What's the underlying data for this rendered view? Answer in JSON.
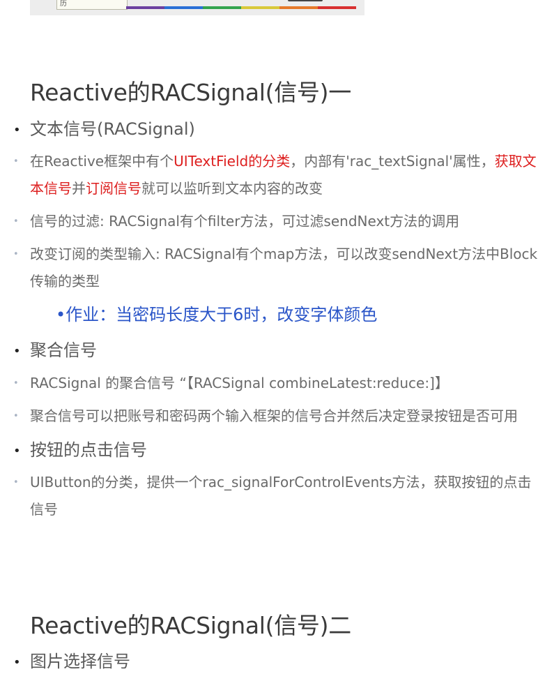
{
  "top_image": {
    "caption_fragment": "历",
    "stripe_colors": [
      "#6b3fa0",
      "#2a6fd6",
      "#33a44e",
      "#d9c93a",
      "#e67a2b",
      "#d83030"
    ]
  },
  "section1": {
    "title": "Reactive的RACSignal(信号)一",
    "items": [
      {
        "level": 1,
        "text": "文本信号(RACSignal)"
      },
      {
        "level": 2,
        "runs": [
          {
            "text": "在Reactive框架中有个",
            "style": "normal"
          },
          {
            "text": "UITextField的分类",
            "style": "red"
          },
          {
            "text": "，内部有'rac_textSignal'属性，",
            "style": "normal"
          },
          {
            "text": "获取文本信号",
            "style": "red"
          },
          {
            "text": "并",
            "style": "normal"
          },
          {
            "text": "订阅信号",
            "style": "red"
          },
          {
            "text": "就可以监听到文本内容的改变",
            "style": "normal"
          }
        ]
      },
      {
        "level": 2,
        "text": "信号的过滤: RACSignal有个filter方法，可过滤sendNext方法的调用"
      },
      {
        "level": 2,
        "text": "改变订阅的类型输入: RACSignal有个map方法，可以改变sendNext方法中Block传输的类型"
      },
      {
        "level": 3,
        "text": "•作业：当密码长度大于6时，改变字体颜色"
      },
      {
        "level": 1,
        "text": "聚合信号"
      },
      {
        "level": 2,
        "text": "RACSignal 的聚合信号 “【RACSignal combineLatest:reduce:]】"
      },
      {
        "level": 2,
        "text": "聚合信号可以把账号和密码两个输入框架的信号合并然后决定登录按钮是否可用"
      },
      {
        "level": 1,
        "text": "按钮的点击信号"
      },
      {
        "level": 2,
        "text": "UIButton的分类，提供一个rac_signalForControlEvents方法，获取按钮的点击信号"
      }
    ]
  },
  "section2": {
    "title": "Reactive的RACSignal(信号)二",
    "items": [
      {
        "level": 1,
        "text": "图片选择信号"
      }
    ]
  },
  "colors": {
    "red": "#dd1e1e",
    "blue": "#2a55c8",
    "title": "#3a3a3a"
  }
}
